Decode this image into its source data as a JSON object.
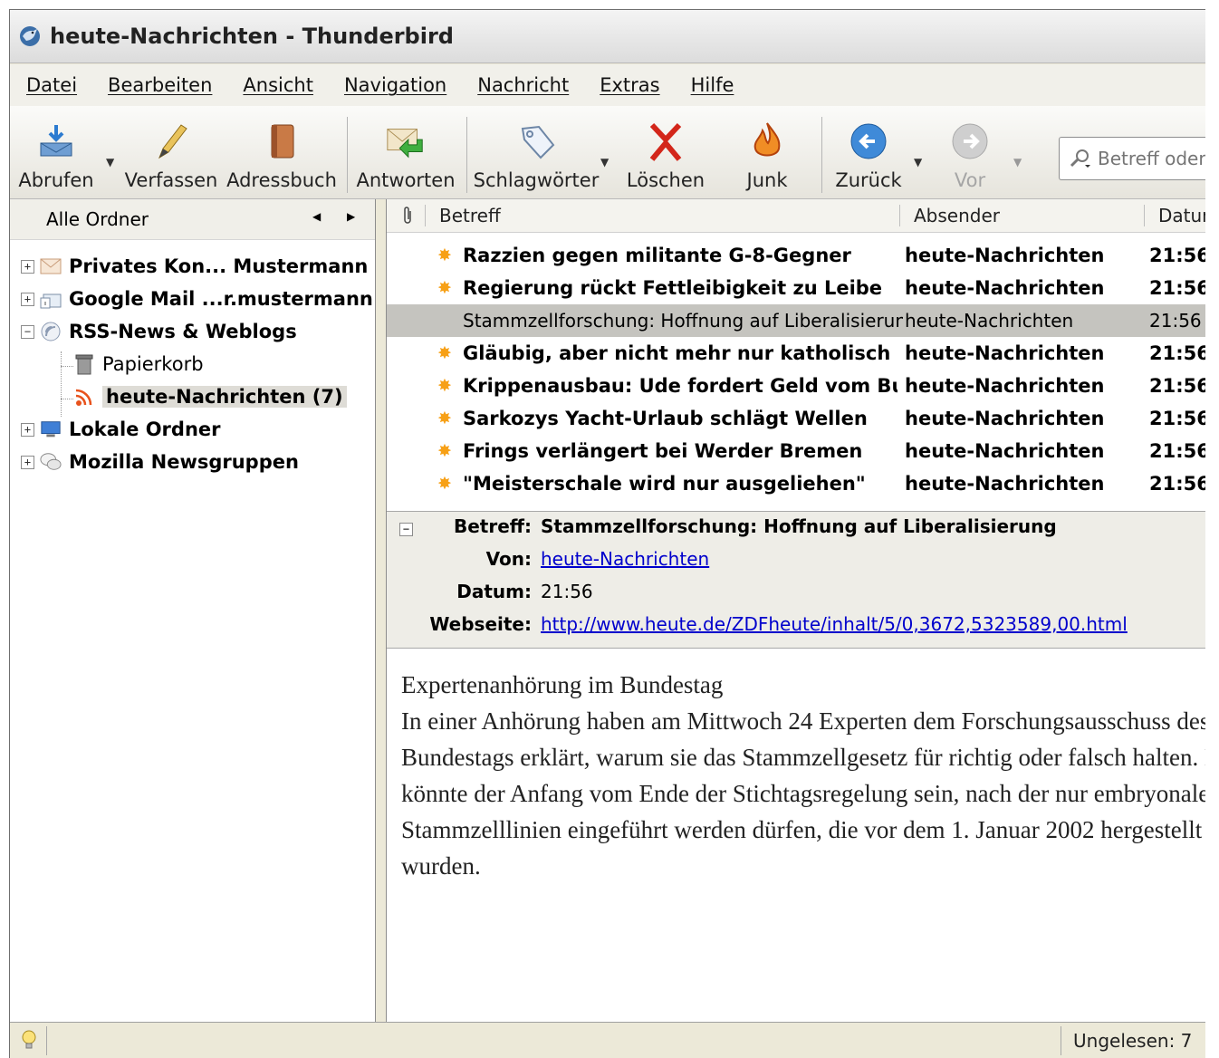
{
  "window": {
    "title": "heute-Nachrichten - Thunderbird"
  },
  "menu": [
    "Datei",
    "Bearbeiten",
    "Ansicht",
    "Navigation",
    "Nachricht",
    "Extras",
    "Hilfe"
  ],
  "toolbar": {
    "abrufen": "Abrufen",
    "verfassen": "Verfassen",
    "adressbuch": "Adressbuch",
    "antworten": "Antworten",
    "schlagwoerter": "Schlagwörter",
    "loeschen": "Löschen",
    "junk": "Junk",
    "zurueck": "Zurück",
    "vor": "Vor",
    "search_placeholder": "Betreff oder Absender"
  },
  "folders": {
    "selector": "Alle Ordner",
    "items": [
      {
        "label": "Privates Kon... Mustermann",
        "icon": "mail-account-icon"
      },
      {
        "label": "Google Mail ...r.mustermann",
        "icon": "google-mail-icon"
      },
      {
        "label": "RSS-News & Weblogs",
        "icon": "rss-account-icon"
      },
      {
        "label": "Papierkorb",
        "icon": "trash-icon"
      },
      {
        "label": "heute-Nachrichten (7)",
        "icon": "rss-feed-icon"
      },
      {
        "label": "Lokale Ordner",
        "icon": "local-folders-icon"
      },
      {
        "label": "Mozilla Newsgruppen",
        "icon": "newsgroups-icon"
      }
    ]
  },
  "columns": {
    "attachment": "attachment-icon",
    "subject": "Betreff",
    "sender": "Absender",
    "date": "Datum"
  },
  "messages": [
    {
      "subject": "Razzien gegen militante G-8-Gegner",
      "sender": "heute-Nachrichten",
      "date": "21:56",
      "unread": true
    },
    {
      "subject": "Regierung rückt Fettleibigkeit zu Leibe",
      "sender": "heute-Nachrichten",
      "date": "21:56",
      "unread": true
    },
    {
      "subject": "Stammzellforschung: Hoffnung auf Liberalisierung",
      "sender": "heute-Nachrichten",
      "date": "21:56",
      "unread": false,
      "selected": true
    },
    {
      "subject": "Gläubig, aber nicht mehr nur katholisch",
      "sender": "heute-Nachrichten",
      "date": "21:56",
      "unread": true
    },
    {
      "subject": "Krippenausbau: Ude fordert Geld vom Bu...",
      "sender": "heute-Nachrichten",
      "date": "21:56",
      "unread": true
    },
    {
      "subject": "Sarkozys Yacht-Urlaub schlägt Wellen",
      "sender": "heute-Nachrichten",
      "date": "21:56",
      "unread": true
    },
    {
      "subject": "Frings verlängert bei Werder Bremen",
      "sender": "heute-Nachrichten",
      "date": "21:56",
      "unread": true
    },
    {
      "subject": "\"Meisterschale wird nur ausgeliehen\"",
      "sender": "heute-Nachrichten",
      "date": "21:56",
      "unread": true
    }
  ],
  "header": {
    "subject_label": "Betreff:",
    "subject": "Stammzellforschung: Hoffnung auf Liberalisierung",
    "from_label": "Von:",
    "from": "heute-Nachrichten",
    "date_label": "Datum:",
    "date": "21:56",
    "website_label": "Webseite:",
    "website": "http://www.heute.de/ZDFheute/inhalt/5/0,3672,5323589,00.html"
  },
  "body": {
    "lines": [
      "Expertenanhörung im Bundestag",
      "In einer Anhörung haben am Mittwoch 24 Experten dem Forschungsausschuss des",
      "Bundestags erklärt, warum sie das Stammzellgesetz für richtig oder falsch halten. Es",
      "könnte der Anfang vom Ende der Stichtagsregelung sein, nach der nur embryonale",
      "Stammzelllinien eingeführt werden dürfen, die vor dem 1. Januar 2002 hergestellt",
      "wurden."
    ]
  },
  "status": {
    "unread": "Ungelesen: 7"
  },
  "colors": {
    "selection": "#c5c4bf",
    "star": "#f7a016",
    "link": "#0000cc",
    "rss": "#e8521c"
  }
}
